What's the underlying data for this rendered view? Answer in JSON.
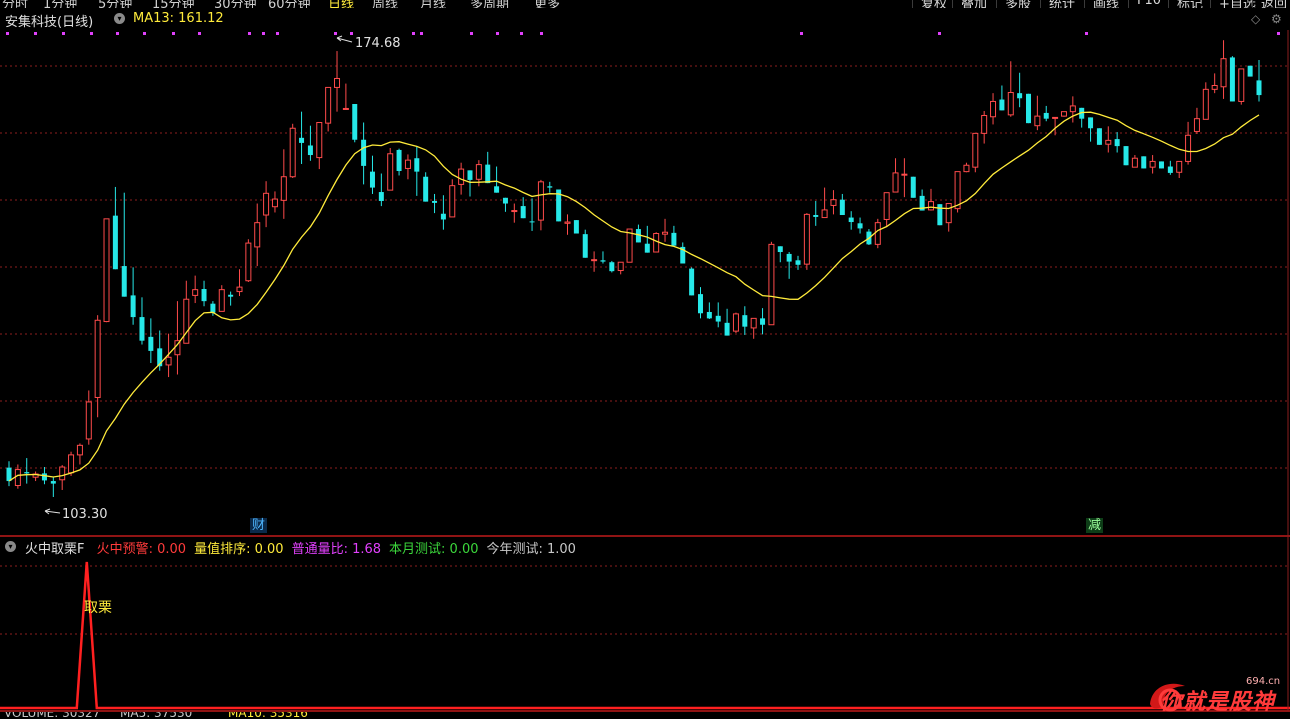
{
  "toolbar": {
    "periods": [
      "分时",
      "1分钟",
      "5分钟",
      "15分钟",
      "30分钟",
      "60分钟",
      "日线",
      "周线",
      "月线",
      "多周期",
      "更多"
    ],
    "buttons": [
      "复权",
      "叠加",
      "多股",
      "统计",
      "画线",
      "F10",
      "标记",
      "+自选",
      "返回"
    ]
  },
  "stock": {
    "name": "安集科技(日线)",
    "ma_label": "MA13: 161.12"
  },
  "markers": {
    "high": "174.68",
    "low": "103.30",
    "cai": "财",
    "jian": "减"
  },
  "indicator": {
    "name": "火中取栗F",
    "items": [
      {
        "text": "火中预警: 0.00",
        "color": "#ff3b3b"
      },
      {
        "text": "量值排序: 0.00",
        "color": "#ffeb3b"
      },
      {
        "text": "普通量比: 1.68",
        "color": "#e040fb"
      },
      {
        "text": "本月测试: 0.00",
        "color": "#3bd63b"
      },
      {
        "text": "今年测试: 1.00",
        "color": "#c8c8c8"
      }
    ],
    "signal_label": "取栗"
  },
  "bottom_strip": {
    "items": [
      {
        "text": "VOLUME: 30327",
        "color": "#c8c8c8"
      },
      {
        "text": "MA5: 37530",
        "color": "#c8c8c8"
      },
      {
        "text": "MA10: 35316",
        "color": "#ffeb3b"
      }
    ]
  },
  "watermark": {
    "text": "你就是股神",
    "domain": "694.cn"
  },
  "colors": {
    "up": "#ff4b4b",
    "down": "#26e8e8",
    "ma": "#ffeb3b",
    "signal": "#ff2020",
    "grid": "#8b1e1e",
    "dot": "#e040fb"
  },
  "chart_data": [
    {
      "type": "candlestick",
      "title": "安集科技(日线)",
      "ylim": [
        99,
        178
      ],
      "ma_series": {
        "name": "MA13",
        "last": 161.12
      },
      "candles": [
        [
          109.4,
          110.4,
          106.5,
          107.3
        ],
        [
          106.6,
          109.9,
          106.1,
          109.1
        ],
        [
          108.7,
          110.9,
          106.9,
          108.5
        ],
        [
          107.9,
          108.8,
          107.3,
          108.4
        ],
        [
          108.5,
          109.5,
          106.8,
          107.4
        ],
        [
          107.3,
          107.9,
          104.8,
          106.9
        ],
        [
          107.5,
          109.8,
          105.9,
          109.5
        ],
        [
          108.6,
          111.9,
          108.1,
          111.4
        ],
        [
          111.4,
          113.2,
          109.9,
          112.9
        ],
        [
          113.9,
          121.5,
          113.0,
          119.7
        ],
        [
          120.4,
          133.3,
          117.3,
          132.5
        ],
        [
          132.3,
          148.4,
          132.2,
          148.4
        ],
        [
          148.9,
          153.4,
          146.5,
          140.5
        ],
        [
          141.0,
          152.5,
          139.9,
          136.2
        ],
        [
          136.4,
          140.8,
          131.8,
          133.0
        ],
        [
          133.0,
          136.1,
          128.7,
          129.3
        ],
        [
          129.9,
          132.8,
          125.8,
          127.7
        ],
        [
          128.1,
          130.9,
          124.6,
          125.3
        ],
        [
          125.5,
          130.4,
          123.6,
          126.7
        ],
        [
          127.1,
          135.5,
          124.0,
          129.3
        ],
        [
          128.9,
          138.7,
          128.9,
          135.8
        ],
        [
          136.4,
          139.5,
          135.2,
          137.3
        ],
        [
          137.4,
          138.7,
          134.7,
          135.5
        ],
        [
          135.1,
          135.5,
          133.2,
          133.7
        ],
        [
          133.9,
          138.0,
          134.8,
          137.3
        ],
        [
          136.5,
          137.0,
          134.8,
          136.2
        ],
        [
          137.0,
          140.5,
          136.3,
          137.7
        ],
        [
          138.7,
          145.2,
          138.5,
          144.6
        ],
        [
          144.0,
          150.8,
          141.0,
          147.8
        ],
        [
          149.0,
          154.3,
          147.1,
          152.4
        ],
        [
          150.3,
          152.7,
          149.4,
          151.5
        ],
        [
          151.3,
          159.3,
          148.4,
          155.0
        ],
        [
          155.0,
          163.3,
          154.8,
          162.6
        ],
        [
          161.1,
          165.2,
          157.0,
          160.3
        ],
        [
          159.9,
          163.0,
          157.5,
          158.4
        ],
        [
          158.0,
          162.6,
          156.2,
          163.5
        ],
        [
          163.4,
          168.6,
          162.1,
          169.0
        ],
        [
          169.0,
          174.7,
          165.2,
          170.4
        ],
        [
          165.7,
          169.6,
          166.7,
          165.7
        ],
        [
          166.4,
          166.4,
          160.4,
          160.8
        ],
        [
          160.8,
          163.5,
          153.8,
          156.7
        ],
        [
          155.8,
          158.3,
          152.3,
          153.3
        ],
        [
          152.6,
          155.5,
          150.4,
          151.2
        ],
        [
          152.9,
          159.5,
          152.9,
          158.6
        ],
        [
          159.2,
          159.4,
          155.2,
          155.9
        ],
        [
          156.3,
          158.5,
          154.6,
          157.6
        ],
        [
          157.9,
          159.7,
          152.0,
          155.8
        ],
        [
          155.0,
          155.7,
          151.1,
          151.1
        ],
        [
          151.2,
          152.3,
          149.3,
          150.9
        ],
        [
          149.2,
          152.1,
          146.7,
          148.3
        ],
        [
          148.7,
          154.6,
          148.8,
          153.6
        ],
        [
          153.8,
          157.2,
          152.2,
          156.2
        ],
        [
          156.0,
          155.6,
          151.9,
          154.5
        ],
        [
          154.6,
          157.6,
          153.5,
          156.9
        ],
        [
          156.9,
          158.9,
          155.8,
          154.0
        ],
        [
          153.5,
          156.6,
          152.9,
          152.5
        ],
        [
          151.7,
          151.7,
          149.5,
          150.8
        ],
        [
          149.6,
          150.8,
          147.8,
          149.7
        ],
        [
          150.4,
          151.8,
          149.8,
          148.5
        ],
        [
          148.0,
          151.6,
          146.5,
          147.9
        ],
        [
          148.2,
          154.5,
          146.6,
          154.2
        ],
        [
          153.5,
          154.2,
          152.5,
          153.3
        ],
        [
          153.0,
          150.8,
          149.9,
          148.0
        ],
        [
          147.7,
          149.1,
          145.9,
          147.9
        ],
        [
          148.2,
          148.0,
          146.6,
          146.1
        ],
        [
          146.0,
          146.7,
          142.5,
          142.3
        ],
        [
          141.9,
          143.3,
          140.1,
          142.0
        ],
        [
          141.9,
          143.3,
          141.4,
          141.7
        ],
        [
          141.6,
          141.8,
          140.0,
          140.2
        ],
        [
          140.3,
          140.6,
          139.7,
          141.6
        ],
        [
          141.6,
          143.9,
          141.9,
          146.8
        ],
        [
          146.8,
          147.5,
          145.4,
          144.7
        ],
        [
          144.5,
          147.3,
          143.4,
          143.1
        ],
        [
          143.2,
          146.3,
          144.4,
          146.1
        ],
        [
          146.0,
          148.4,
          144.8,
          146.3
        ],
        [
          146.2,
          147.3,
          144.1,
          144.2
        ],
        [
          144.0,
          144.7,
          141.7,
          141.4
        ],
        [
          140.6,
          140.8,
          136.6,
          136.4
        ],
        [
          136.6,
          137.7,
          132.8,
          133.6
        ],
        [
          133.8,
          135.3,
          132.7,
          132.8
        ],
        [
          133.2,
          135.3,
          131.4,
          132.3
        ],
        [
          132.1,
          134.3,
          130.4,
          130.1
        ],
        [
          130.8,
          133.7,
          130.5,
          133.5
        ],
        [
          133.3,
          134.7,
          130.2,
          131.5
        ],
        [
          131.3,
          131.6,
          129.6,
          132.8
        ],
        [
          132.8,
          134.4,
          130.3,
          131.8
        ],
        [
          131.8,
          144.8,
          131.9,
          144.4
        ],
        [
          144.1,
          142.3,
          141.6,
          143.2
        ],
        [
          142.9,
          143.2,
          139.0,
          141.7
        ],
        [
          141.9,
          142.6,
          140.4,
          141.2
        ],
        [
          141.3,
          149.3,
          140.4,
          149.1
        ],
        [
          149.0,
          151.2,
          147.3,
          148.7
        ],
        [
          148.6,
          153.3,
          148.9,
          149.8
        ],
        [
          150.5,
          152.9,
          149.1,
          151.4
        ],
        [
          151.4,
          152.3,
          150.4,
          149.0
        ],
        [
          148.6,
          149.6,
          146.7,
          147.9
        ],
        [
          147.7,
          148.6,
          146.1,
          146.9
        ],
        [
          146.4,
          146.8,
          144.3,
          144.4
        ],
        [
          144.4,
          148.4,
          143.8,
          147.8
        ],
        [
          148.3,
          152.5,
          147.1,
          152.5
        ],
        [
          152.6,
          157.9,
          152.7,
          155.6
        ],
        [
          155.3,
          157.9,
          151.8,
          155.4
        ],
        [
          155.0,
          154.5,
          152.5,
          151.7
        ],
        [
          152.0,
          153.0,
          149.7,
          149.7
        ],
        [
          149.8,
          153.1,
          149.7,
          151.1
        ],
        [
          150.7,
          150.5,
          147.8,
          147.4
        ],
        [
          147.8,
          150.4,
          146.4,
          150.8
        ],
        [
          150.0,
          151.6,
          149.4,
          155.8
        ],
        [
          155.8,
          157.2,
          155.7,
          156.8
        ],
        [
          156.5,
          161.7,
          155.7,
          161.8
        ],
        [
          161.8,
          165.3,
          160.2,
          164.6
        ],
        [
          164.4,
          168.1,
          163.2,
          166.8
        ],
        [
          167.1,
          169.3,
          166.2,
          165.4
        ],
        [
          164.7,
          173.1,
          164.4,
          168.2
        ],
        [
          168.1,
          171.3,
          165.9,
          167.3
        ],
        [
          168.0,
          165.7,
          164.5,
          163.4
        ],
        [
          163.0,
          167.7,
          162.3,
          164.5
        ],
        [
          165.0,
          166.1,
          163.7,
          164.1
        ],
        [
          164.2,
          163.7,
          161.5,
          164.3
        ],
        [
          164.5,
          165.2,
          164.4,
          165.2
        ],
        [
          165.2,
          167.6,
          163.5,
          166.1
        ],
        [
          165.8,
          164.4,
          162.7,
          164.1
        ],
        [
          164.3,
          163.9,
          160.5,
          162.6
        ],
        [
          162.6,
          160.8,
          160.1,
          160.0
        ],
        [
          160.1,
          162.9,
          158.8,
          160.7
        ],
        [
          160.9,
          162.0,
          158.8,
          159.8
        ],
        [
          159.8,
          158.7,
          157.6,
          156.8
        ],
        [
          156.5,
          158.4,
          156.5,
          157.9
        ],
        [
          158.2,
          157.9,
          156.5,
          156.3
        ],
        [
          156.5,
          158.4,
          155.5,
          157.4
        ],
        [
          157.4,
          156.7,
          156.9,
          156.3
        ],
        [
          156.6,
          157.5,
          155.3,
          155.6
        ],
        [
          155.7,
          156.8,
          154.8,
          157.4
        ],
        [
          157.4,
          163.6,
          156.9,
          161.5
        ],
        [
          162.1,
          165.8,
          161.7,
          164.1
        ],
        [
          164.0,
          169.8,
          164.8,
          168.7
        ],
        [
          168.7,
          171.2,
          168.1,
          169.3
        ],
        [
          169.1,
          176.4,
          167.2,
          173.5
        ],
        [
          173.7,
          173.9,
          167.5,
          166.8
        ],
        [
          166.8,
          171.6,
          166.3,
          171.9
        ],
        [
          172.4,
          171.4,
          170.7,
          170.7
        ],
        [
          170.1,
          173.3,
          166.8,
          167.8
        ]
      ]
    },
    {
      "type": "line",
      "title": "火中取栗F",
      "series": [
        {
          "name": "",
          "peak_index": 9,
          "peak_value": 1,
          "baseline": 0
        }
      ]
    }
  ]
}
